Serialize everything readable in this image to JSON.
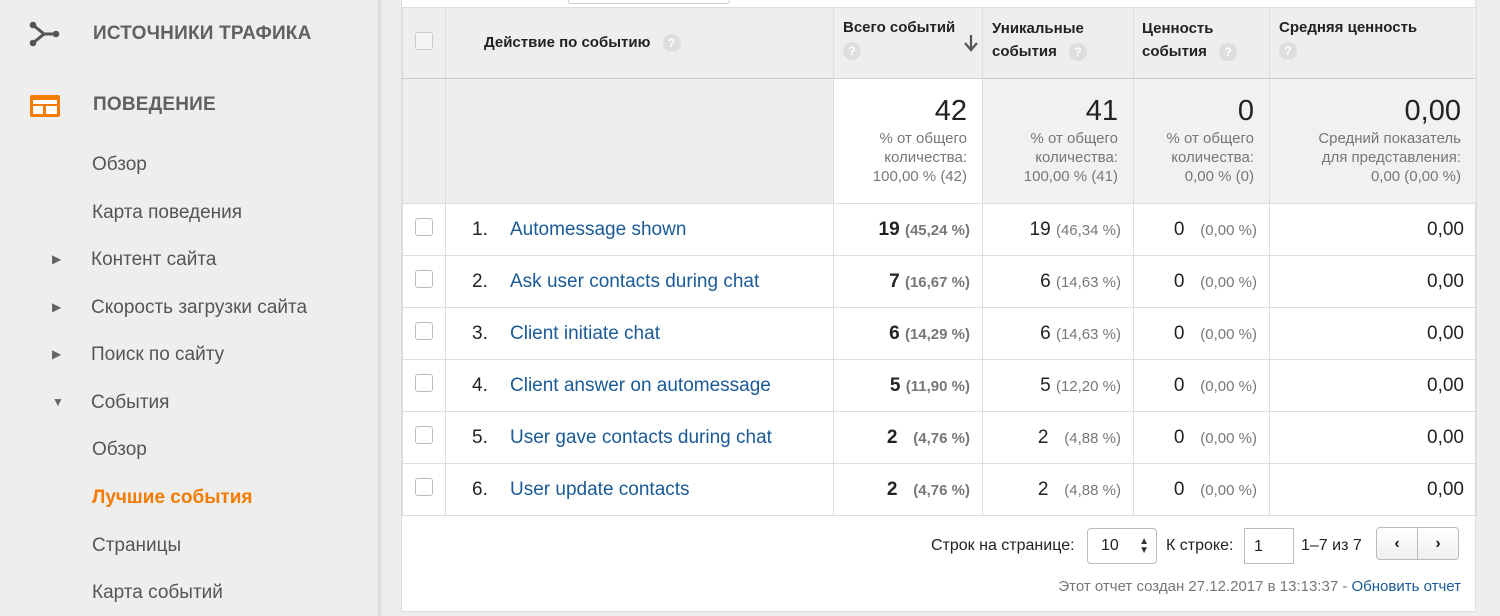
{
  "sidebar": {
    "sections": [
      {
        "label": "Источники трафика",
        "icon": "traffic-sources-icon"
      },
      {
        "label": "Поведение",
        "icon": "behavior-icon",
        "accent": "#f57c00"
      }
    ],
    "items": [
      {
        "label": "Обзор"
      },
      {
        "label": "Карта поведения"
      },
      {
        "label": "Контент сайта",
        "arrow": "▶"
      },
      {
        "label": "Скорость загрузки сайта",
        "arrow": "▶"
      },
      {
        "label": "Поиск по сайту",
        "arrow": "▶"
      },
      {
        "label": "События",
        "arrow": "▼"
      },
      {
        "label": "Обзор"
      },
      {
        "label": "Лучшие события",
        "active": true
      },
      {
        "label": "Страницы"
      },
      {
        "label": "Карта событий"
      }
    ]
  },
  "table": {
    "headers": {
      "action": "Действие по событию",
      "total": "Всего событий",
      "unique_1": "Уникальные",
      "unique_2": "события",
      "value_1": "Ценность",
      "value_2": "события",
      "avg": "Средняя ценность"
    },
    "help": "?",
    "sort_icon": "🡓",
    "totals": {
      "total": {
        "value": "42",
        "line1": "% от общего",
        "line2": "количества:",
        "line3": "100,00 % (42)"
      },
      "unique": {
        "value": "41",
        "line1": "% от общего",
        "line2": "количества:",
        "line3": "100,00 % (41)"
      },
      "value": {
        "value": "0",
        "line1": "% от общего",
        "line2": "количества:",
        "line3": "0,00 % (0)"
      },
      "avg": {
        "value": "0,00",
        "line1": "Средний показатель",
        "line2": "для представления:",
        "line3": "0,00 (0,00 %)"
      }
    },
    "rows": [
      {
        "num": "1.",
        "event": "Automessage shown",
        "total": "19",
        "total_pct": "(45,24 %)",
        "unique": "19",
        "unique_pct": "(46,34 %)",
        "value": "0",
        "value_pct": "(0,00 %)",
        "avg": "0,00"
      },
      {
        "num": "2.",
        "event": "Ask user contacts during chat",
        "total": "7",
        "total_pct": "(16,67 %)",
        "unique": "6",
        "unique_pct": "(14,63 %)",
        "value": "0",
        "value_pct": "(0,00 %)",
        "avg": "0,00"
      },
      {
        "num": "3.",
        "event": "Client initiate chat",
        "total": "6",
        "total_pct": "(14,29 %)",
        "unique": "6",
        "unique_pct": "(14,63 %)",
        "value": "0",
        "value_pct": "(0,00 %)",
        "avg": "0,00"
      },
      {
        "num": "4.",
        "event": "Client answer on automessage",
        "total": "5",
        "total_pct": "(11,90 %)",
        "unique": "5",
        "unique_pct": "(12,20 %)",
        "value": "0",
        "value_pct": "(0,00 %)",
        "avg": "0,00"
      },
      {
        "num": "5.",
        "event": "User gave contacts during chat",
        "total": "2",
        "total_pct": "(4,76 %)",
        "unique": "2",
        "unique_pct": "(4,88 %)",
        "value": "0",
        "value_pct": "(0,00 %)",
        "avg": "0,00"
      },
      {
        "num": "6.",
        "event": "User update contacts",
        "total": "2",
        "total_pct": "(4,76 %)",
        "unique": "2",
        "unique_pct": "(4,88 %)",
        "value": "0",
        "value_pct": "(0,00 %)",
        "avg": "0,00"
      }
    ]
  },
  "pagination": {
    "rows_label": "Строк на странице:",
    "rows_value": "10",
    "goto_label": "К строке:",
    "goto_value": "1",
    "range": "1–7 из 7",
    "prev": "‹",
    "next": "›"
  },
  "footer": {
    "created": "Этот отчет создан 27.12.2017 в 13:13:37 -",
    "refresh": "Обновить отчет"
  }
}
